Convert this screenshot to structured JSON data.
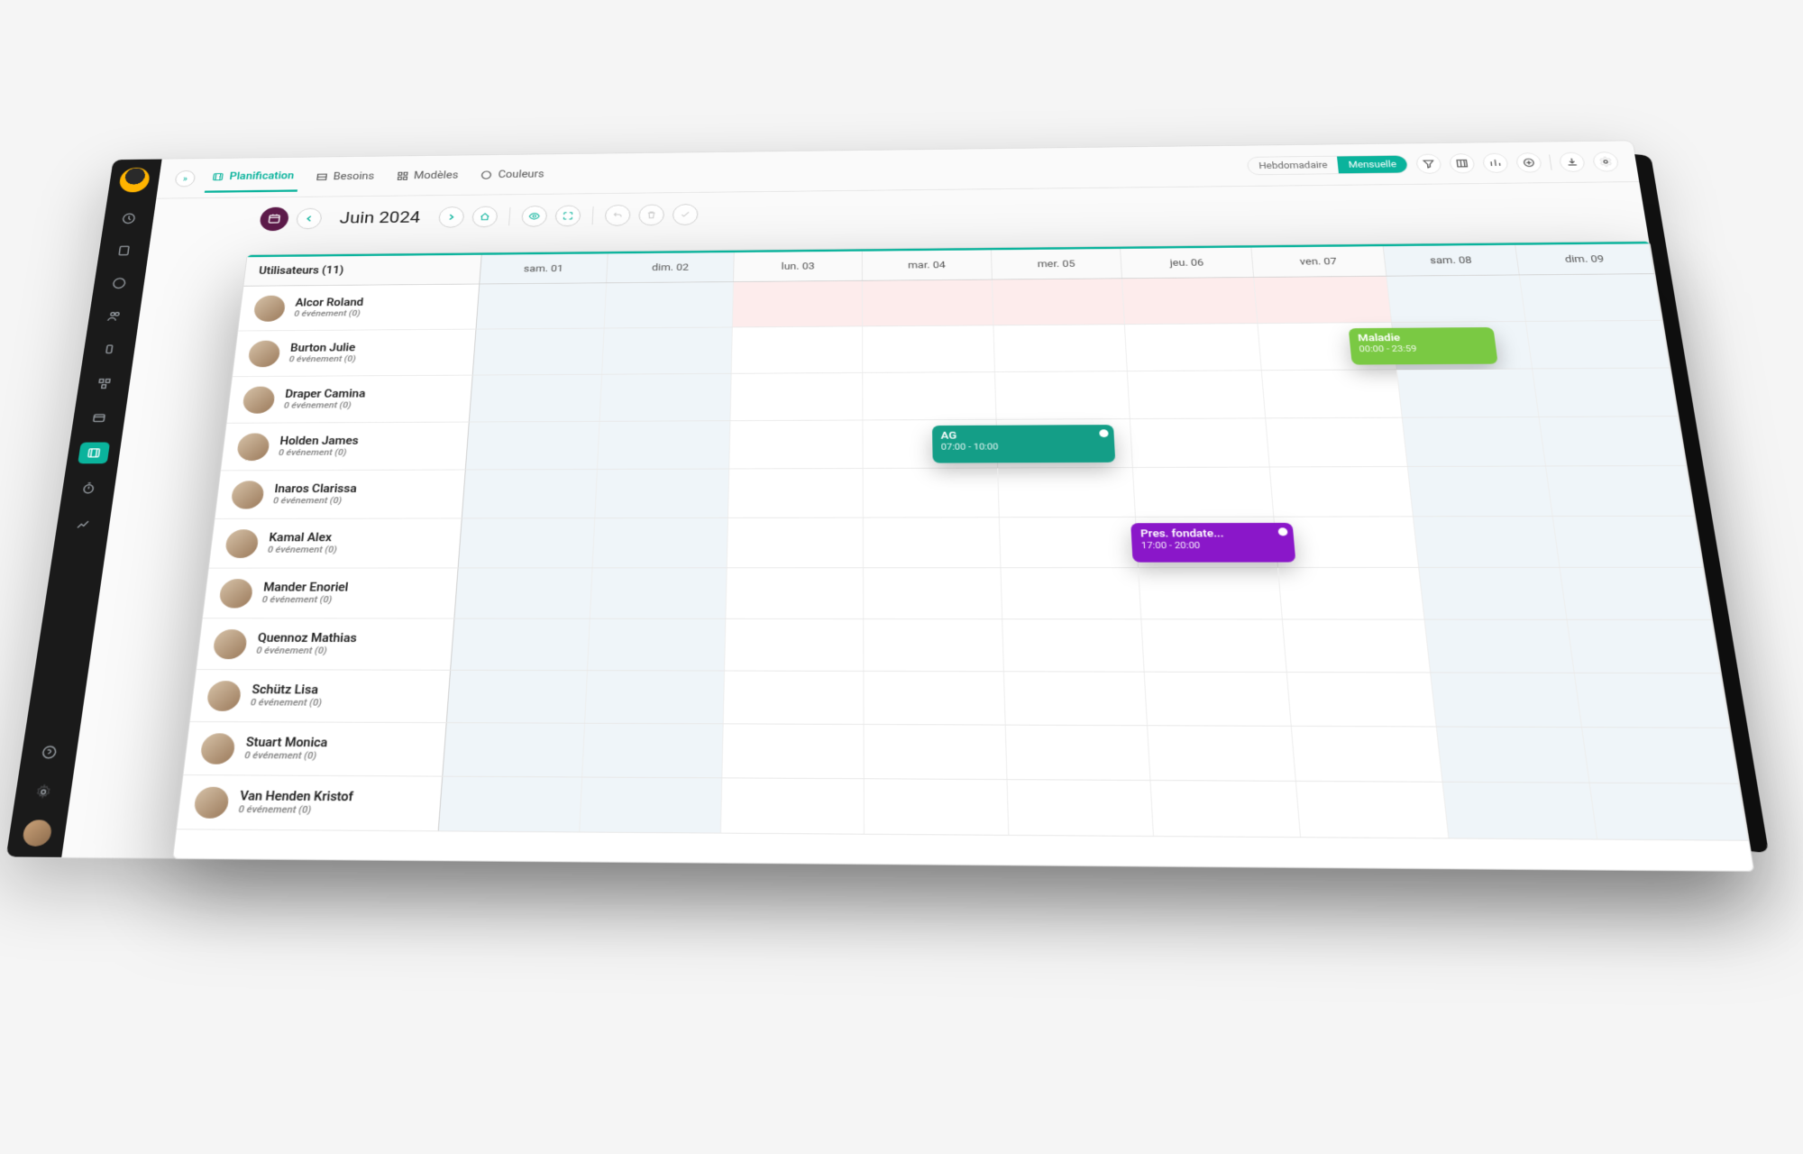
{
  "tabs": {
    "planification": "Planification",
    "besoins": "Besoins",
    "modeles": "Modèles",
    "couleurs": "Couleurs"
  },
  "view_toggle": {
    "weekly": "Hebdomadaire",
    "monthly": "Mensuelle"
  },
  "month_label": "Juin 2024",
  "users_header": "Utilisateurs (11)",
  "event_sub_template": "0 événement (0)",
  "days": [
    "sam. 01",
    "dim. 02",
    "lun. 03",
    "mar. 04",
    "mer. 05",
    "jeu. 06",
    "ven. 07",
    "sam. 08",
    "dim. 09"
  ],
  "users": [
    {
      "name": "Alcor Roland",
      "pink": true
    },
    {
      "name": "Burton Julie"
    },
    {
      "name": "Draper Camina"
    },
    {
      "name": "Holden James"
    },
    {
      "name": "Inaros Clarissa"
    },
    {
      "name": "Kamal Alex"
    },
    {
      "name": "Mander Enoriel"
    },
    {
      "name": "Quennoz Mathias"
    },
    {
      "name": "Schütz Lisa"
    },
    {
      "name": "Stuart Monica"
    },
    {
      "name": "Van Henden Kristof"
    }
  ],
  "events": [
    {
      "row": 1,
      "title": "Maladie",
      "time": "00:00 - 23:59",
      "color": "#7ac943",
      "left_pct": 74,
      "width_pct": 12
    },
    {
      "row": 3,
      "title": "AG",
      "time": "07:00 - 10:00",
      "color": "#149e87",
      "left_pct": 39,
      "width_pct": 15,
      "dot": true
    },
    {
      "row": 5,
      "title": "Pres. fondate...",
      "time": "17:00 - 20:00",
      "color": "#8a17c9",
      "left_pct": 55,
      "width_pct": 13,
      "dot": true
    }
  ],
  "colors": {
    "accent": "#0ab39c",
    "sidebar": "#1a1a1a",
    "cal_btn": "#5d1b4a"
  }
}
